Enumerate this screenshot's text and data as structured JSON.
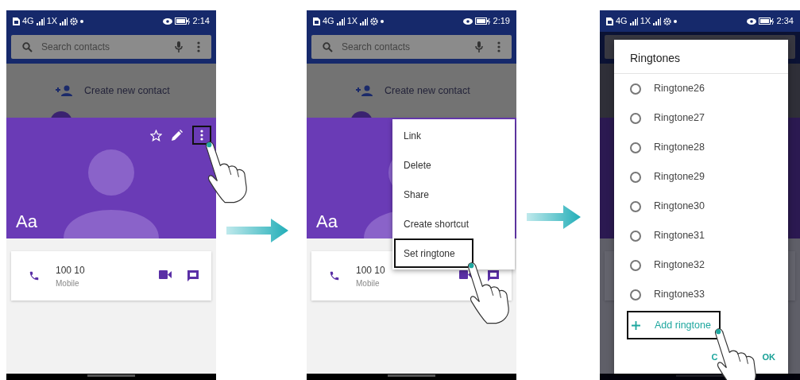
{
  "screens": [
    {
      "status_bar": {
        "network_1": "4G",
        "network_2": "1X",
        "time": "2:14"
      },
      "search": {
        "placeholder": "Search contacts"
      },
      "create_contact": "Create new contact",
      "contact": {
        "name": "Aa",
        "more_button": {
          "highlighted": true
        },
        "phone": {
          "number": "100 10",
          "type": "Mobile"
        }
      }
    },
    {
      "status_bar": {
        "network_1": "4G",
        "network_2": "1X",
        "time": "2:19"
      },
      "search": {
        "placeholder": "Search contacts"
      },
      "create_contact": "Create new contact",
      "contact": {
        "name": "Aa",
        "phone": {
          "number": "100 10",
          "type": "Mobile"
        }
      },
      "menu": [
        {
          "label": "Link",
          "highlighted": false
        },
        {
          "label": "Delete",
          "highlighted": false
        },
        {
          "label": "Share",
          "highlighted": false
        },
        {
          "label": "Create shortcut",
          "highlighted": false
        },
        {
          "label": "Set ringtone",
          "highlighted": true
        }
      ]
    },
    {
      "status_bar": {
        "network_1": "4G",
        "network_2": "1X",
        "time": "2:34"
      },
      "dialog": {
        "title": "Ringtones",
        "options": [
          {
            "label": "Ringtone26",
            "selected": false
          },
          {
            "label": "Ringtone27",
            "selected": false
          },
          {
            "label": "Ringtone28",
            "selected": false
          },
          {
            "label": "Ringtone29",
            "selected": false
          },
          {
            "label": "Ringtone30",
            "selected": false
          },
          {
            "label": "Ringtone31",
            "selected": false
          },
          {
            "label": "Ringtone32",
            "selected": false
          },
          {
            "label": "Ringtone33",
            "selected": false
          }
        ],
        "add_action": {
          "label": "Add ringtone",
          "highlighted": true
        },
        "buttons": [
          {
            "kind": "cancel",
            "label": "C"
          },
          {
            "kind": "ok",
            "label": "OK"
          }
        ]
      }
    }
  ]
}
